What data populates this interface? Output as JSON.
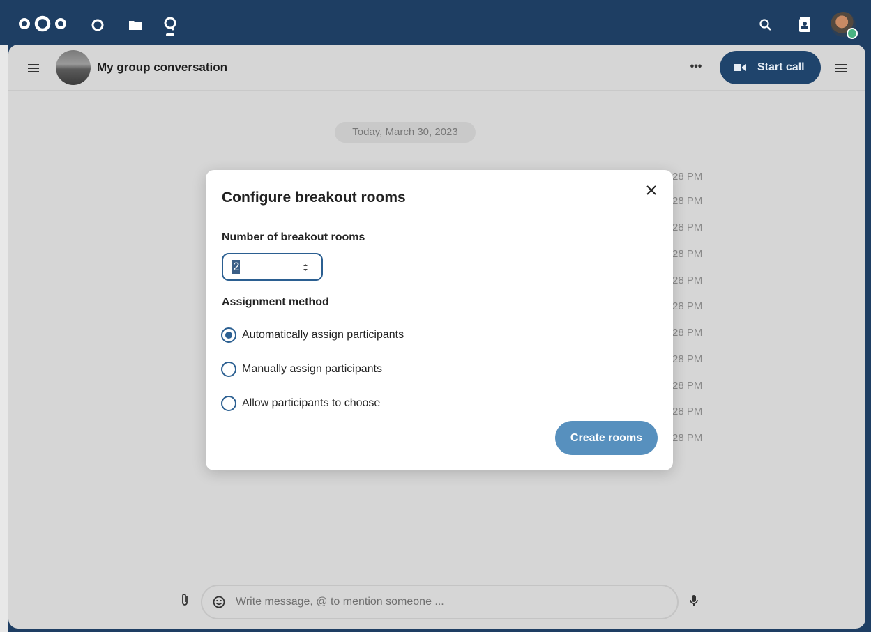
{
  "topbar": {
    "icons": [
      "nextcloud-logo",
      "dashboard-icon",
      "files-icon",
      "talk-icon",
      "search-icon",
      "contacts-icon",
      "user-avatar"
    ]
  },
  "conversation": {
    "title": "My group conversation",
    "more_label": "•••",
    "start_call_label": "Start call"
  },
  "chat": {
    "date_separator": "Today, March 30, 2023",
    "timestamps": [
      "28 PM",
      "28 PM",
      "28 PM",
      "28 PM",
      "28 PM",
      "28 PM",
      "28 PM",
      "28 PM",
      "28 PM",
      "28 PM",
      "28 PM"
    ]
  },
  "composer": {
    "placeholder": "Write message, @ to mention someone ..."
  },
  "modal": {
    "title": "Configure breakout rooms",
    "number_label": "Number of breakout rooms",
    "number_value": "2",
    "assignment_label": "Assignment method",
    "options": [
      {
        "label": "Automatically assign participants",
        "checked": true
      },
      {
        "label": "Manually assign participants",
        "checked": false
      },
      {
        "label": "Allow participants to choose",
        "checked": false
      }
    ],
    "create_label": "Create rooms"
  },
  "colors": {
    "header_bg": "#1e3e63",
    "primary": "#2b5f91",
    "create_button": "#5790be",
    "status_online": "#49b382"
  }
}
